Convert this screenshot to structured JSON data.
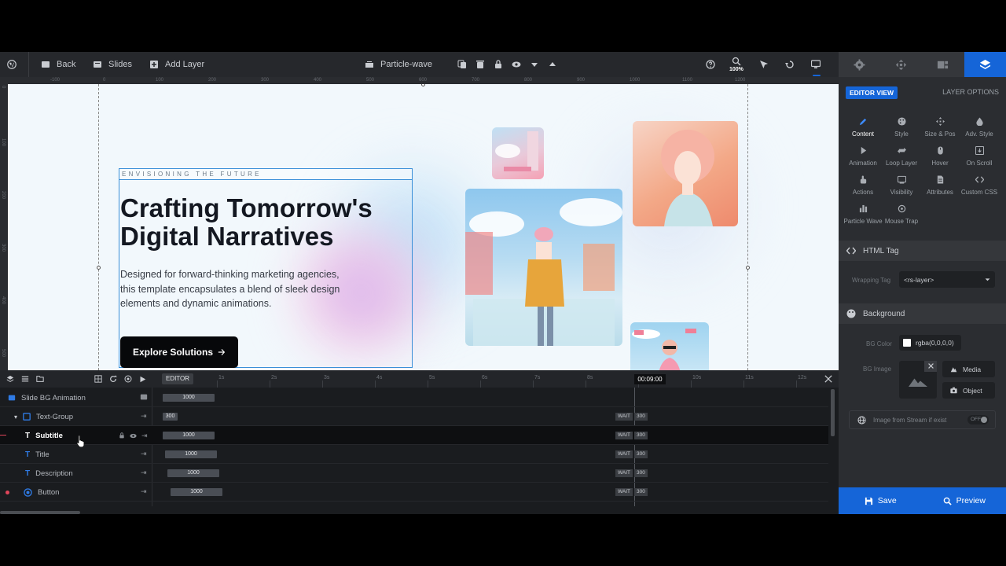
{
  "toolbar": {
    "back_label": "Back",
    "slides_label": "Slides",
    "add_layer_label": "Add Layer",
    "slide_name": "Particle-wave",
    "zoom_level": "100%"
  },
  "ruler": {
    "top_ticks": [
      "-100",
      "0",
      "100",
      "200",
      "300",
      "400",
      "500",
      "600",
      "700",
      "800",
      "900",
      "1000",
      "1100",
      "1200"
    ],
    "left_ticks": [
      "0",
      "100",
      "200",
      "300",
      "400",
      "500"
    ]
  },
  "hero": {
    "subtitle": "ENVISIONING THE FUTURE",
    "title_line1": "Crafting Tomorrow's",
    "title_line2": "Digital Narratives",
    "description": "Designed for forward-thinking marketing agencies, this template encapsulates a blend of sleek design elements and dynamic animations.",
    "button_label": "Explore Solutions"
  },
  "panel": {
    "editor_view": "EDITOR VIEW",
    "layer_options": "LAYER OPTIONS",
    "options": [
      {
        "label": "Content"
      },
      {
        "label": "Style"
      },
      {
        "label": "Size & Pos"
      },
      {
        "label": "Adv. Style"
      },
      {
        "label": "Animation"
      },
      {
        "label": "Loop Layer"
      },
      {
        "label": "Hover"
      },
      {
        "label": "On Scroll"
      },
      {
        "label": "Actions"
      },
      {
        "label": "Visibility"
      },
      {
        "label": "Attributes"
      },
      {
        "label": "Custom CSS"
      },
      {
        "label": "Particle Wave"
      },
      {
        "label": "Mouse Trap"
      }
    ],
    "html_tag_title": "HTML Tag",
    "wrapping_tag_label": "Wrapping Tag",
    "wrapping_tag_value": "<rs-layer>",
    "background_title": "Background",
    "bg_color_label": "BG Color",
    "bg_color_value": "rgba(0,0,0,0)",
    "bg_image_label": "BG Image",
    "media_label": "Media",
    "object_label": "Object",
    "stream_label": "Image from Stream if exist",
    "stream_toggle": "OFF",
    "save_label": "Save",
    "preview_label": "Preview"
  },
  "timeline": {
    "editor_label": "EDITOR",
    "current_time": "00:09:00",
    "ticks": [
      "1s",
      "2s",
      "3s",
      "4s",
      "5s",
      "6s",
      "7s",
      "8s",
      "9s",
      "10s",
      "11s",
      "12s"
    ],
    "wait_label": "WAIT",
    "rows": [
      {
        "name": "Slide BG Animation",
        "duration": "1000",
        "wait": ""
      },
      {
        "name": "Text-Group",
        "duration": "300",
        "wait": "300"
      },
      {
        "name": "Subtitle",
        "duration": "1000",
        "wait": "300"
      },
      {
        "name": "Title",
        "duration": "1000",
        "wait": "300"
      },
      {
        "name": "Description",
        "duration": "1000",
        "wait": "300"
      },
      {
        "name": "Button",
        "duration": "1000",
        "wait": "300"
      }
    ]
  },
  "colors": {
    "accent": "#1565d8",
    "selection": "#3a8fd8",
    "canvas_bg": "#f2f8fc",
    "toolbar_bg": "#26282c",
    "panel_bg": "#2b2d31",
    "keyframe_dot": "#e0455a"
  }
}
